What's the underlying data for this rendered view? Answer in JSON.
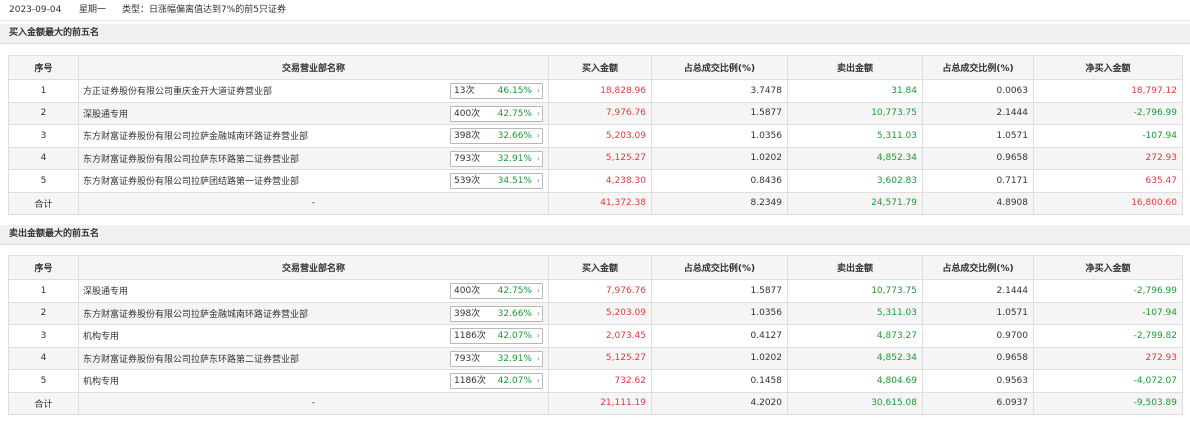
{
  "header": {
    "date": "2023-09-04",
    "weekday": "星期一",
    "type_label": "类型：日涨幅偏离值达到7%的前5只证券"
  },
  "columns": [
    "序号",
    "交易营业部名称",
    "买入金额",
    "占总成交比例(%)",
    "卖出金额",
    "占总成交比例(%)",
    "净买入金额"
  ],
  "buy_section": {
    "title": "买入金额最大的前五名",
    "rows": [
      {
        "no": "1",
        "name": "方正证券股份有限公司重庆金开大道证券营业部",
        "times": "13次",
        "pct": "46.15%",
        "buy": "18,828.96",
        "buy_ratio": "3.7478",
        "sell": "31.84",
        "sell_ratio": "0.0063",
        "net": "18,797.12",
        "net_sign": "pos"
      },
      {
        "no": "2",
        "name": "深股通专用",
        "times": "400次",
        "pct": "42.75%",
        "buy": "7,976.76",
        "buy_ratio": "1.5877",
        "sell": "10,773.75",
        "sell_ratio": "2.1444",
        "net": "-2,796.99",
        "net_sign": "neg"
      },
      {
        "no": "3",
        "name": "东方财富证券股份有限公司拉萨金融城南环路证券营业部",
        "times": "398次",
        "pct": "32.66%",
        "buy": "5,203.09",
        "buy_ratio": "1.0356",
        "sell": "5,311.03",
        "sell_ratio": "1.0571",
        "net": "-107.94",
        "net_sign": "neg"
      },
      {
        "no": "4",
        "name": "东方财富证券股份有限公司拉萨东环路第二证券营业部",
        "times": "793次",
        "pct": "32.91%",
        "buy": "5,125.27",
        "buy_ratio": "1.0202",
        "sell": "4,852.34",
        "sell_ratio": "0.9658",
        "net": "272.93",
        "net_sign": "pos"
      },
      {
        "no": "5",
        "name": "东方财富证券股份有限公司拉萨团结路第一证券营业部",
        "times": "539次",
        "pct": "34.51%",
        "buy": "4,238.30",
        "buy_ratio": "0.8436",
        "sell": "3,602.83",
        "sell_ratio": "0.7171",
        "net": "635.47",
        "net_sign": "pos"
      }
    ],
    "total": {
      "label": "合计",
      "name": "-",
      "buy": "41,372.38",
      "buy_ratio": "8.2349",
      "sell": "24,571.79",
      "sell_ratio": "4.8908",
      "net": "16,800.60",
      "net_sign": "pos"
    }
  },
  "sell_section": {
    "title": "卖出金额最大的前五名",
    "rows": [
      {
        "no": "1",
        "name": "深股通专用",
        "times": "400次",
        "pct": "42.75%",
        "buy": "7,976.76",
        "buy_ratio": "1.5877",
        "sell": "10,773.75",
        "sell_ratio": "2.1444",
        "net": "-2,796.99",
        "net_sign": "neg"
      },
      {
        "no": "2",
        "name": "东方财富证券股份有限公司拉萨金融城南环路证券营业部",
        "times": "398次",
        "pct": "32.66%",
        "buy": "5,203.09",
        "buy_ratio": "1.0356",
        "sell": "5,311.03",
        "sell_ratio": "1.0571",
        "net": "-107.94",
        "net_sign": "neg"
      },
      {
        "no": "3",
        "name": "机构专用",
        "times": "1186次",
        "pct": "42.07%",
        "buy": "2,073.45",
        "buy_ratio": "0.4127",
        "sell": "4,873.27",
        "sell_ratio": "0.9700",
        "net": "-2,799.82",
        "net_sign": "neg"
      },
      {
        "no": "4",
        "name": "东方财富证券股份有限公司拉萨东环路第二证券营业部",
        "times": "793次",
        "pct": "32.91%",
        "buy": "5,125.27",
        "buy_ratio": "1.0202",
        "sell": "4,852.34",
        "sell_ratio": "0.9658",
        "net": "272.93",
        "net_sign": "pos"
      },
      {
        "no": "5",
        "name": "机构专用",
        "times": "1186次",
        "pct": "42.07%",
        "buy": "732.62",
        "buy_ratio": "0.1458",
        "sell": "4,804.69",
        "sell_ratio": "0.9563",
        "net": "-4,072.07",
        "net_sign": "neg"
      }
    ],
    "total": {
      "label": "合计",
      "name": "-",
      "buy": "21,111.19",
      "buy_ratio": "4.2020",
      "sell": "30,615.08",
      "sell_ratio": "6.0937",
      "net": "-9,503.89",
      "net_sign": "neg"
    }
  },
  "colors": {
    "up": "#e4393c",
    "down": "#1a9b35"
  },
  "icons": {
    "tag_arrow": "chevron-right-icon"
  }
}
